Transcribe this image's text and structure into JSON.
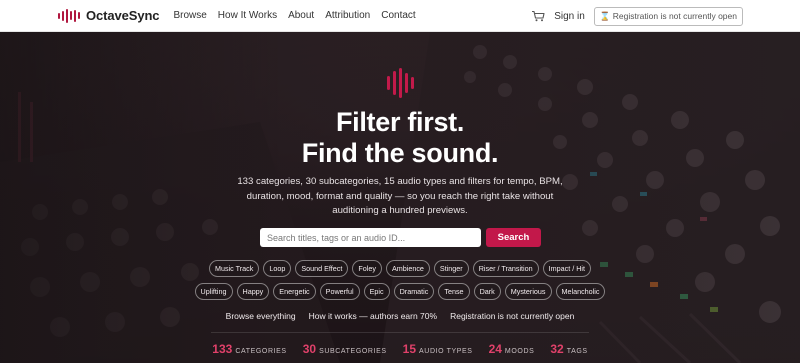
{
  "brand": {
    "name": "OctaveSync",
    "accent": "#c2184a"
  },
  "nav": {
    "links": [
      "Browse",
      "How It Works",
      "About",
      "Attribution",
      "Contact"
    ],
    "cart_icon": "cart-icon",
    "signin": "Sign in",
    "registration_badge": "⌛ Registration is not currently open"
  },
  "hero": {
    "title_line1": "Filter first.",
    "title_line2": "Find the sound.",
    "description": "133 categories, 30 subcategories, 15 audio types and filters for tempo, BPM, duration, mood, format and quality — so you reach the right take without auditioning a hundred previews.",
    "search": {
      "placeholder": "Search titles, tags or an audio ID...",
      "button": "Search"
    },
    "chips_row1": [
      "Music Track",
      "Loop",
      "Sound Effect",
      "Foley",
      "Ambience",
      "Stinger",
      "Riser / Transition",
      "Impact / Hit"
    ],
    "chips_row2": [
      "Uplifting",
      "Happy",
      "Energetic",
      "Powerful",
      "Epic",
      "Dramatic",
      "Tense",
      "Dark",
      "Mysterious",
      "Melancholic"
    ],
    "links": [
      "Browse everything",
      "How it works — authors earn 70%",
      "Registration is not currently open"
    ],
    "stats": [
      {
        "num": "133",
        "label": "CATEGORIES"
      },
      {
        "num": "30",
        "label": "SUBCATEGORIES"
      },
      {
        "num": "15",
        "label": "AUDIO TYPES"
      },
      {
        "num": "24",
        "label": "MOODS"
      },
      {
        "num": "32",
        "label": "TAGS"
      }
    ]
  }
}
